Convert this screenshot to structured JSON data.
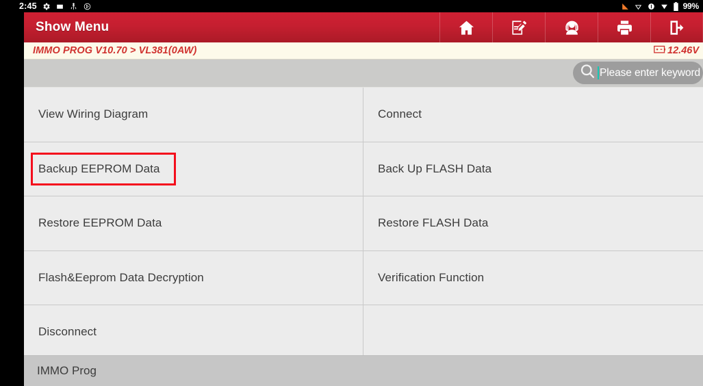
{
  "statusbar": {
    "clock": "2:45",
    "battery_percent": "99%",
    "left_icons": [
      "settings-gear-icon",
      "sd-card-icon",
      "usb-icon",
      "bluetooth-disabled-icon"
    ],
    "right_icons": [
      "signal-icon",
      "wifi-off-icon",
      "vpn-key-icon",
      "download-icon",
      "battery-icon"
    ]
  },
  "titlebar": {
    "title": "Show Menu",
    "buttons": [
      {
        "name": "home-button",
        "icon": "home-icon"
      },
      {
        "name": "feedback-button",
        "icon": "edit-note-icon"
      },
      {
        "name": "support-button",
        "icon": "headset-person-icon"
      },
      {
        "name": "print-button",
        "icon": "printer-icon"
      },
      {
        "name": "exit-button",
        "icon": "exit-door-icon"
      }
    ]
  },
  "breadcrumb": {
    "path": "IMMO PROG V10.70 > VL381(0AW)",
    "voltage": "12.46V",
    "battery_icon": "battery-voltage-icon"
  },
  "search": {
    "placeholder": "Please enter keyword",
    "value": "",
    "icon": "search-icon"
  },
  "menu": {
    "rows": [
      {
        "left": "View Wiring Diagram",
        "right": "Connect"
      },
      {
        "left": "Backup EEPROM Data",
        "right": "Back Up FLASH Data"
      },
      {
        "left": "Restore EEPROM Data",
        "right": "Restore FLASH Data"
      },
      {
        "left": "Flash&Eeprom Data Decryption",
        "right": "Verification Function"
      },
      {
        "left": "Disconnect",
        "right": ""
      }
    ],
    "highlighted_item": "Backup EEPROM Data"
  },
  "bottombar": {
    "label": "IMMO Prog"
  },
  "colors": {
    "brand_red": "#c51f30",
    "accent_red": "#d0322f",
    "highlight_red": "#f40d1c",
    "breadcrumb_bg": "#fdfaea",
    "cell_bg": "#ececec",
    "bottombar_bg": "#c6c6c6",
    "caret_teal": "#14c7b4"
  }
}
